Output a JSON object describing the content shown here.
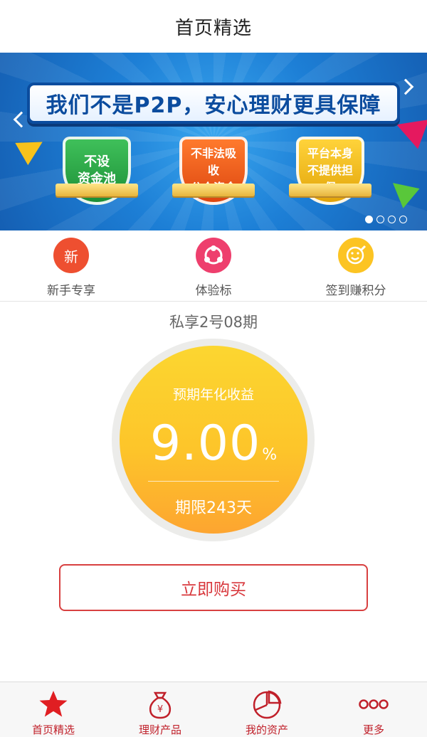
{
  "header": {
    "title": "首页精选"
  },
  "banner": {
    "slogan": "我们不是P2P，安心理财更具保障",
    "badges": [
      "不设\n资金池",
      "不非法吸收\n公众资金",
      "平台本身\n不提供担保"
    ],
    "slide_count": 4,
    "active_slide": 1
  },
  "shortcuts": [
    {
      "label": "新手专享",
      "icon_text": "新",
      "icon": "new-icon",
      "color": "#ee4f30"
    },
    {
      "label": "体验标",
      "icon": "share-nodes-icon",
      "color": "#ee3f6d"
    },
    {
      "label": "签到赚积分",
      "icon": "smile-sign-icon",
      "color": "#fcc423"
    }
  ],
  "product": {
    "name": "私享2号08期",
    "yield_label": "预期年化收益",
    "yield_value": "9.00",
    "yield_unit": "%",
    "term": "期限243天",
    "buy_label": "立即购买"
  },
  "tabbar": [
    {
      "label": "首页精选",
      "icon": "star-icon",
      "active": true
    },
    {
      "label": "理财产品",
      "icon": "money-bag-icon",
      "active": false
    },
    {
      "label": "我的资产",
      "icon": "pie-chart-icon",
      "active": false
    },
    {
      "label": "更多",
      "icon": "more-dots-icon",
      "active": false
    }
  ],
  "colors": {
    "accent": "#d8373c",
    "yield_disc": "#fdc52a"
  }
}
